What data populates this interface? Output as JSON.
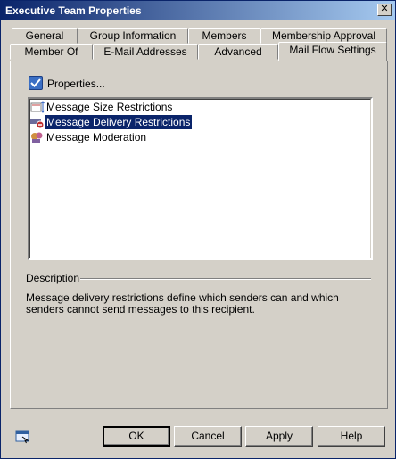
{
  "window": {
    "title": "Executive Team Properties",
    "close_symbol": "✕"
  },
  "tabs_row1": [
    {
      "label": "General"
    },
    {
      "label": "Group Information"
    },
    {
      "label": "Members"
    },
    {
      "label": "Membership Approval"
    }
  ],
  "tabs_row2": [
    {
      "label": "Member Of"
    },
    {
      "label": "E-Mail Addresses"
    },
    {
      "label": "Advanced"
    },
    {
      "label": "Mail Flow Settings"
    }
  ],
  "active_tab": "Mail Flow Settings",
  "properties_button": {
    "label": "Properties..."
  },
  "settings_list": [
    {
      "label": "Message Size Restrictions",
      "icon": "size-restrictions-icon"
    },
    {
      "label": "Message Delivery Restrictions",
      "icon": "delivery-restrictions-icon",
      "selected": true
    },
    {
      "label": "Message Moderation",
      "icon": "moderation-icon"
    }
  ],
  "description": {
    "label": "Description",
    "text": "Message delivery restrictions define which senders can and which senders cannot send messages to this recipient."
  },
  "buttons": {
    "ok": "OK",
    "cancel": "Cancel",
    "apply": "Apply",
    "help": "Help"
  },
  "colors": {
    "title_bar": "#0a246a",
    "selection": "#0a246a",
    "dialog_bg": "#d4d0c8"
  }
}
